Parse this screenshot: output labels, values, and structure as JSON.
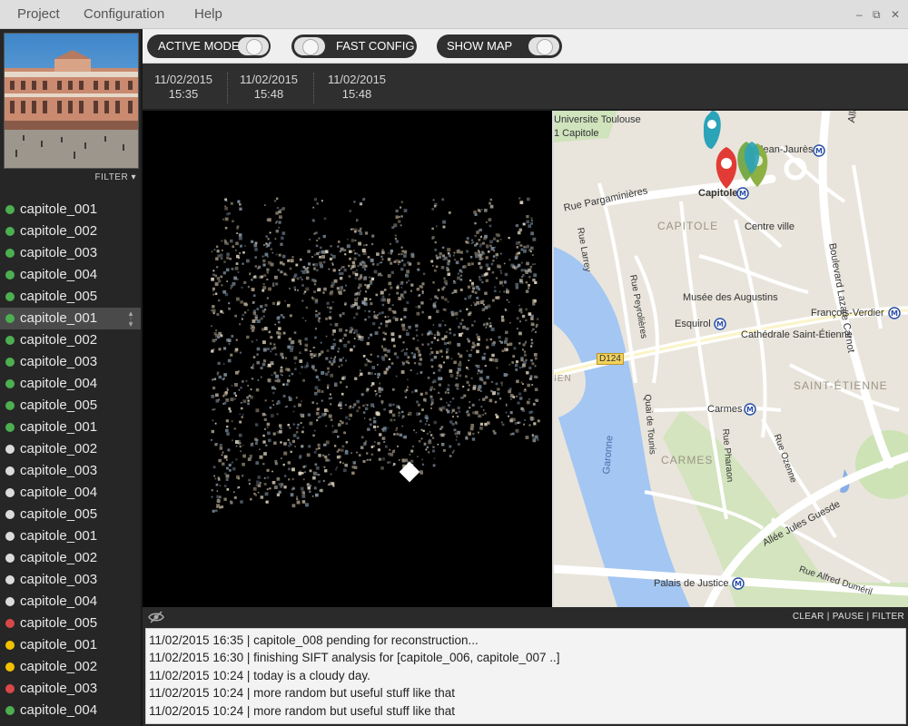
{
  "menu": {
    "items": [
      "Project",
      "Configuration",
      "Help"
    ]
  },
  "window_controls": {
    "minimize": "–",
    "restore": "⧉",
    "close": "✕"
  },
  "sidebar": {
    "filter_label": "FILTER ▾",
    "files": [
      {
        "name": "capitole_001",
        "status": "green"
      },
      {
        "name": "capitole_002",
        "status": "green"
      },
      {
        "name": "capitole_003",
        "status": "green"
      },
      {
        "name": "capitole_004",
        "status": "green"
      },
      {
        "name": "capitole_005",
        "status": "green"
      },
      {
        "name": "capitole_001",
        "status": "green",
        "selected": true
      },
      {
        "name": "capitole_002",
        "status": "green"
      },
      {
        "name": "capitole_003",
        "status": "green"
      },
      {
        "name": "capitole_004",
        "status": "green"
      },
      {
        "name": "capitole_005",
        "status": "green"
      },
      {
        "name": "capitole_001",
        "status": "green"
      },
      {
        "name": "capitole_002",
        "status": "white"
      },
      {
        "name": "capitole_003",
        "status": "white"
      },
      {
        "name": "capitole_004",
        "status": "white"
      },
      {
        "name": "capitole_005",
        "status": "white"
      },
      {
        "name": "capitole_001",
        "status": "white"
      },
      {
        "name": "capitole_002",
        "status": "white"
      },
      {
        "name": "capitole_003",
        "status": "white"
      },
      {
        "name": "capitole_004",
        "status": "white"
      },
      {
        "name": "capitole_005",
        "status": "red"
      },
      {
        "name": "capitole_001",
        "status": "yellow"
      },
      {
        "name": "capitole_002",
        "status": "yellow"
      },
      {
        "name": "capitole_003",
        "status": "red"
      },
      {
        "name": "capitole_004",
        "status": "green"
      }
    ]
  },
  "status_colors": {
    "green": "#4caf50",
    "white": "#dcdcdc",
    "red": "#d94848",
    "yellow": "#f2c200"
  },
  "toolbar": {
    "active_mode": "ACTIVE MODE",
    "fast_config": "FAST CONFIG",
    "show_map": "SHOW MAP"
  },
  "timeline": {
    "stamps": [
      {
        "date": "11/02/2015",
        "time": "15:35"
      },
      {
        "date": "11/02/2015",
        "time": "15:48"
      },
      {
        "date": "11/02/2015",
        "time": "15:48"
      }
    ]
  },
  "map": {
    "labels": {
      "univ1": "Universite Toulouse",
      "univ2": "1 Capitole",
      "jean_jaures": "Jean-Jaurès",
      "capitole": "Capitole",
      "rue_pargaminieres": "Rue Pargaminières",
      "capitole_area": "CAPITOLE",
      "centre_ville": "Centre ville",
      "rue_larrey": "Rue Larrey",
      "boulevard": "Boulevard Lazare Carnot",
      "rue_peyrolieres": "Rue Peyrolières",
      "musee": "Musée des Augustins",
      "esquirol": "Esquirol",
      "francois_verdier": "François-Verdier",
      "cathedrale": "Cathédrale Saint-Étienne",
      "d124": "D124",
      "ien": "IEN",
      "saint_etienne": "SAINT-ÉTIENNE",
      "carmes": "Carmes",
      "carmes_area": "CARMES",
      "quai": "Quai de Tounis",
      "rue_pharaon": "Rue Pharaon",
      "rue_ozenne": "Rue Ozenne",
      "garonne": "Garonne",
      "allee": "Allée Jules Guesde",
      "palais": "Palais de Justice",
      "rue_alfred": "Rue Alfred Duméril",
      "alle": "Alle"
    }
  },
  "log": {
    "controls": {
      "clear": "CLEAR",
      "sep1": " | ",
      "pause": "PAUSE",
      "sep2": " | ",
      "filter": "FILTER"
    },
    "lines": [
      "11/02/2015 16:35 | capitole_008 pending for reconstruction...",
      "11/02/2015 16:30 | finishing SIFT analysis for [capitole_006, capitole_007 ..]",
      "11/02/2015 10:24 | today is a cloudy day.",
      "11/02/2015 10:24 | more random but useful stuff like that",
      "11/02/2015 10:24 | more random but useful stuff like that"
    ]
  }
}
